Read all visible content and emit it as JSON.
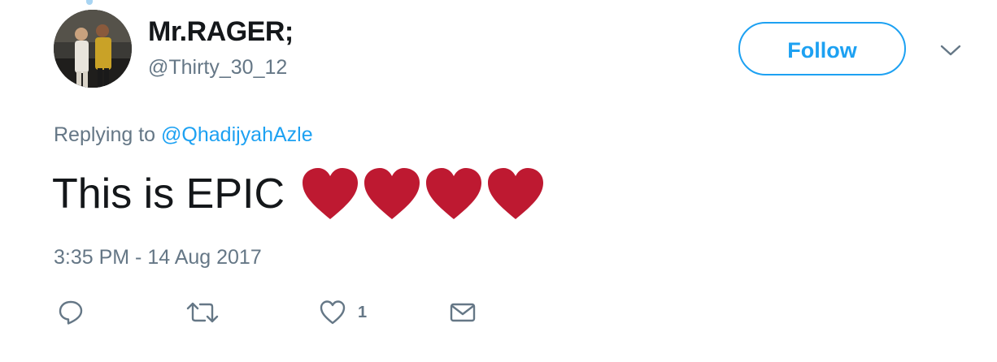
{
  "tweet": {
    "author": {
      "display_name": "Mr.RAGER;",
      "handle": "@Thirty_30_12",
      "avatar_icon": "profile-photo"
    },
    "follow_label": "Follow",
    "replying_prefix": "Replying to",
    "replying_to": "@QhadijyahAzle",
    "text": "This is EPIC",
    "emoji": [
      "red-heart",
      "red-heart",
      "red-heart",
      "red-heart"
    ],
    "timestamp": "3:35 PM - 14 Aug 2017",
    "actions": {
      "reply_icon": "reply-icon",
      "retweet_icon": "retweet-icon",
      "like_icon": "heart-outline-icon",
      "like_count": "1",
      "dm_icon": "envelope-icon"
    }
  },
  "colors": {
    "link": "#1da1f2",
    "secondary_text": "#657786",
    "primary_text": "#14171a",
    "heart_emoji": "#be1931"
  }
}
